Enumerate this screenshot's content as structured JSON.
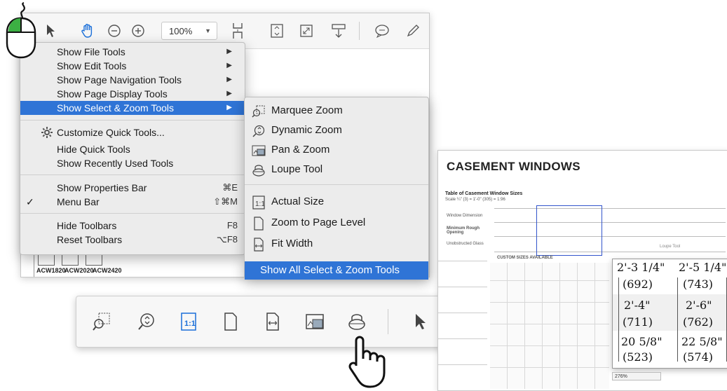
{
  "toolbar": {
    "zoom_value": "100%"
  },
  "main_menu": {
    "items": [
      {
        "label": "Show File Tools"
      },
      {
        "label": "Show Edit Tools"
      },
      {
        "label": "Show Page Navigation Tools"
      },
      {
        "label": "Show Page Display Tools"
      },
      {
        "label": "Show Select & Zoom Tools"
      },
      {
        "label": "Customize Quick Tools..."
      },
      {
        "label": "Hide Quick Tools"
      },
      {
        "label": "Show Recently Used Tools"
      },
      {
        "label": "Show Properties Bar",
        "shortcut": "⌘E"
      },
      {
        "label": "Menu Bar",
        "shortcut": "⇧⌘M",
        "check": "✓"
      },
      {
        "label": "Hide Toolbars",
        "shortcut": "F8"
      },
      {
        "label": "Reset Toolbars",
        "shortcut": "⌥F8"
      }
    ]
  },
  "sub_menu": {
    "items": [
      {
        "label": "Marquee Zoom",
        "icon": "marquee-zoom-icon"
      },
      {
        "label": "Dynamic Zoom",
        "icon": "dynamic-zoom-icon"
      },
      {
        "label": "Pan & Zoom",
        "icon": "pan-zoom-icon"
      },
      {
        "label": "Loupe Tool",
        "icon": "loupe-icon"
      },
      {
        "label": "Actual Size",
        "icon": "actual-size-icon"
      },
      {
        "label": "Zoom to Page Level",
        "icon": "page-icon"
      },
      {
        "label": "Fit Width",
        "icon": "fit-width-icon"
      },
      {
        "label": "Show All Select & Zoom Tools"
      }
    ]
  },
  "background_doc": {
    "labels": [
      "ACW1820",
      "ACW2020",
      "ACW2420"
    ]
  },
  "document": {
    "title": "CASEMENT WINDOWS",
    "table_title": "Table of Casement Window Sizes",
    "scale": "Scale ¼\" (3) = 1'-0\" (305) = 1:96",
    "row_labels": [
      "Window Dimension",
      "Minimum Rough Opening",
      "Unobstructed Glass"
    ],
    "custom_sizes": "CUSTOM SIZES AVAILABLE",
    "zoom_level": "276%",
    "loupe_title": "Loupe Tool",
    "zoom_card": {
      "col1": [
        "2'-3 1/4\"",
        "(692)",
        "2'-4\"",
        "(711)",
        "20 5/8\"",
        "(523)"
      ],
      "col2": [
        "2'-5 1/4\"",
        "(743)",
        "2'-6\"",
        "(762)",
        "22 5/8\"",
        "(574)"
      ]
    }
  },
  "colors": {
    "highlight": "#2f74d6",
    "hand_tool_blue": "#1a6fd9",
    "mouse_button_green": "#3cb043"
  }
}
